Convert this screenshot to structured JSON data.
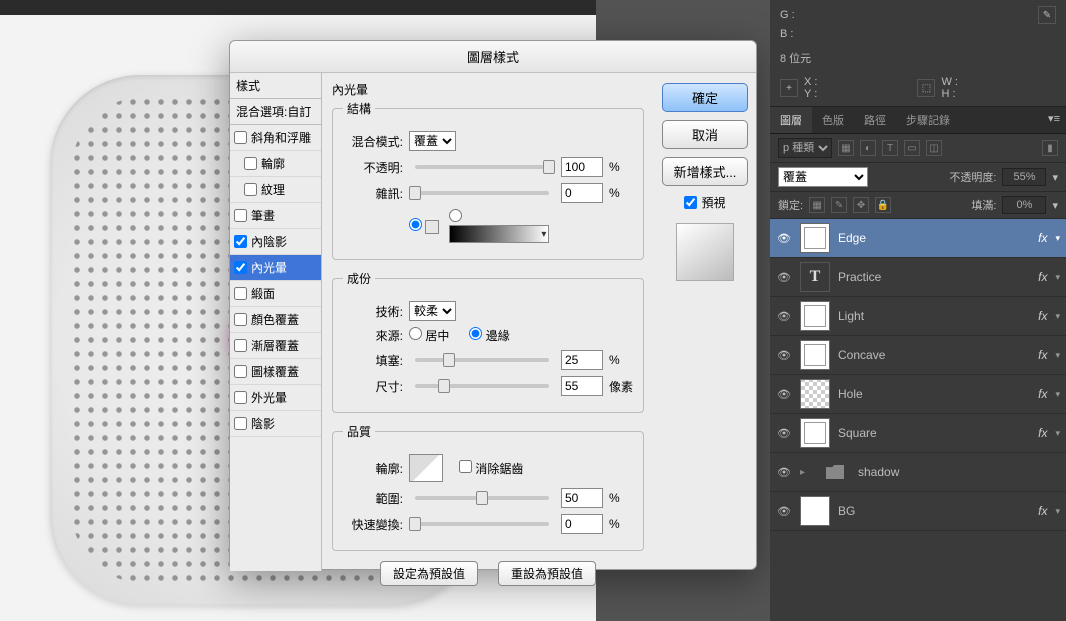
{
  "dialog": {
    "title": "圖層樣式",
    "styles_header": "樣式",
    "blend_options": "混合選項:自訂",
    "style_items": [
      {
        "label": "斜角和浮雕",
        "checked": false
      },
      {
        "label": "輪廓",
        "checked": false
      },
      {
        "label": "紋理",
        "checked": false
      },
      {
        "label": "筆畫",
        "checked": false
      },
      {
        "label": "內陰影",
        "checked": true
      },
      {
        "label": "內光暈",
        "checked": true,
        "selected": true
      },
      {
        "label": "緞面",
        "checked": false
      },
      {
        "label": "顏色覆蓋",
        "checked": false
      },
      {
        "label": "漸層覆蓋",
        "checked": false
      },
      {
        "label": "圖樣覆蓋",
        "checked": false
      },
      {
        "label": "外光暈",
        "checked": false
      },
      {
        "label": "陰影",
        "checked": false
      }
    ],
    "section_innerglow": "內光暈",
    "group_structure": "結構",
    "blend_mode_label": "混合模式:",
    "blend_mode_value": "覆蓋",
    "opacity_label": "不透明:",
    "opacity_value": "100",
    "noise_label": "雜訊:",
    "noise_value": "0",
    "pct": "%",
    "group_elements": "成份",
    "technique_label": "技術:",
    "technique_value": "較柔",
    "source_label": "來源:",
    "source_center": "居中",
    "source_edge": "邊緣",
    "choke_label": "填塞:",
    "choke_value": "25",
    "size_label": "尺寸:",
    "size_value": "55",
    "px": "像素",
    "group_quality": "品質",
    "contour_label": "輪廓:",
    "antialias_label": "消除鋸齒",
    "range_label": "範圍:",
    "range_value": "50",
    "jitter_label": "快速變換:",
    "jitter_value": "0",
    "make_default": "設定為預設值",
    "reset_default": "重設為預設值",
    "ok": "確定",
    "cancel": "取消",
    "new_style": "新增樣式...",
    "preview": "預視"
  },
  "info": {
    "g": "G :",
    "b": "B :",
    "bits": "8 位元",
    "x": "X :",
    "y": "Y :",
    "w": "W :",
    "h": "H :"
  },
  "panels": {
    "tabs": [
      "圖層",
      "色版",
      "路徑",
      "步驟記錄"
    ],
    "kind_filter": "p 種類",
    "blend_mode": "覆蓋",
    "opacity_label": "不透明度:",
    "opacity_value": "55%",
    "lock_label": "鎖定:",
    "fill_label": "填滿:",
    "fill_value": "0%",
    "fx": "fx",
    "layers": [
      {
        "name": "Edge",
        "type": "mask",
        "selected": true,
        "fx": true,
        "eye": true
      },
      {
        "name": "Practice",
        "type": "text",
        "fx": true,
        "eye": true
      },
      {
        "name": "Light",
        "type": "mask",
        "fx": true,
        "eye": true
      },
      {
        "name": "Concave",
        "type": "mask",
        "fx": true,
        "eye": true
      },
      {
        "name": "Hole",
        "type": "checker",
        "fx": true,
        "eye": true
      },
      {
        "name": "Square",
        "type": "mask",
        "fx": true,
        "eye": true
      },
      {
        "name": "shadow",
        "type": "folder",
        "fx": false,
        "eye": true,
        "arrow": true
      },
      {
        "name": "BG",
        "type": "plain",
        "fx": true,
        "eye": true
      }
    ]
  }
}
